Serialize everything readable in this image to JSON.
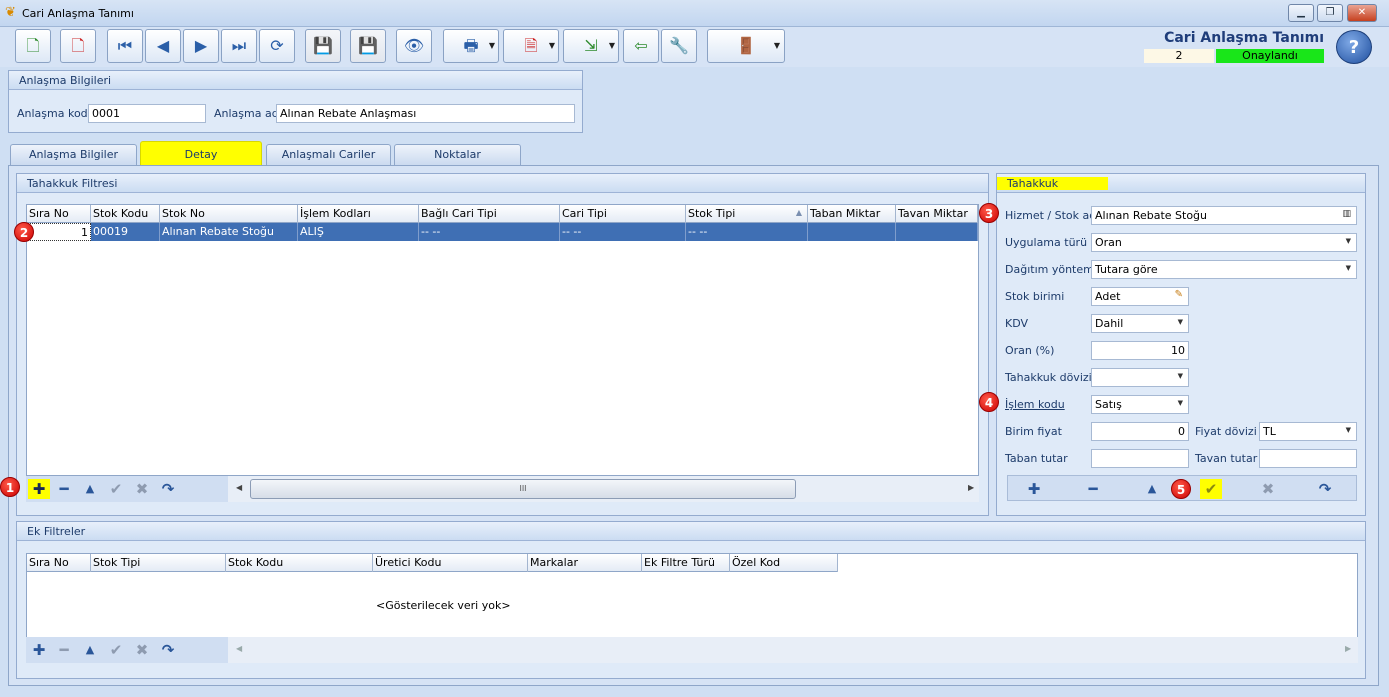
{
  "window": {
    "title": "Cari Anlaşma Tanımı"
  },
  "header": {
    "title": "Cari Anlaşma Tanımı",
    "record_no": "2",
    "status": "Onaylandı",
    "status_color": "#19e619"
  },
  "info": {
    "section_title": "Anlaşma Bilgileri",
    "code_label": "Anlaşma kodu",
    "code_value": "0001",
    "name_label": "Anlaşma adı",
    "name_value": "Alınan Rebate Anlaşması"
  },
  "tabs": [
    {
      "label": "Anlaşma Bilgiler"
    },
    {
      "label": "Detay"
    },
    {
      "label": "Anlaşmalı Cariler"
    },
    {
      "label": "Noktalar"
    }
  ],
  "filter": {
    "section_title": "Tahakkuk Filtresi",
    "columns": [
      "Sıra No",
      "Stok Kodu",
      "Stok No",
      "İşlem Kodları",
      "Bağlı Cari Tipi",
      "Cari Tipi",
      "Stok Tipi",
      "Taban Miktar",
      "Tavan Miktar"
    ],
    "rows": [
      [
        "1",
        "00019",
        "Alınan Rebate Stoğu",
        "ALIŞ",
        "-- --",
        "-- --",
        "-- --",
        "",
        ""
      ]
    ]
  },
  "tahakkuk": {
    "section_title": "Tahakkuk",
    "hizmet_label": "Hizmet / Stok adı",
    "hizmet_value": "Alınan Rebate Stoğu",
    "uygulama_label": "Uygulama türü",
    "uygulama_value": "Oran",
    "dagitim_label": "Dağıtım yöntemi",
    "dagitim_value": "Tutara göre",
    "stok_birimi_label": "Stok birimi",
    "stok_birimi_value": "Adet",
    "kdv_label": "KDV",
    "kdv_value": "Dahil",
    "oran_label": "Oran (%)",
    "oran_value": "10",
    "doviz_label": "Tahakkuk dövizi",
    "doviz_value": "",
    "islem_label": "İşlem kodu",
    "islem_value": "Satış",
    "birim_fiyat_label": "Birim fiyat",
    "birim_fiyat_value": "0",
    "fiyat_doviz_label": "Fiyat dövizi",
    "fiyat_doviz_value": "TL",
    "taban_label": "Taban tutar",
    "taban_value": "",
    "tavan_label": "Tavan tutar",
    "tavan_value": ""
  },
  "ek": {
    "section_title": "Ek Filtreler",
    "columns": [
      "Sıra No",
      "Stok Tipi",
      "Stok Kodu",
      "Üretici Kodu",
      "Markalar",
      "Ek Filtre Türü",
      "Özel Kod"
    ],
    "empty_text": "<Gösterilecek veri yok>"
  },
  "badges": [
    "1",
    "2",
    "3",
    "4",
    "5"
  ],
  "scroll_grip": "III"
}
